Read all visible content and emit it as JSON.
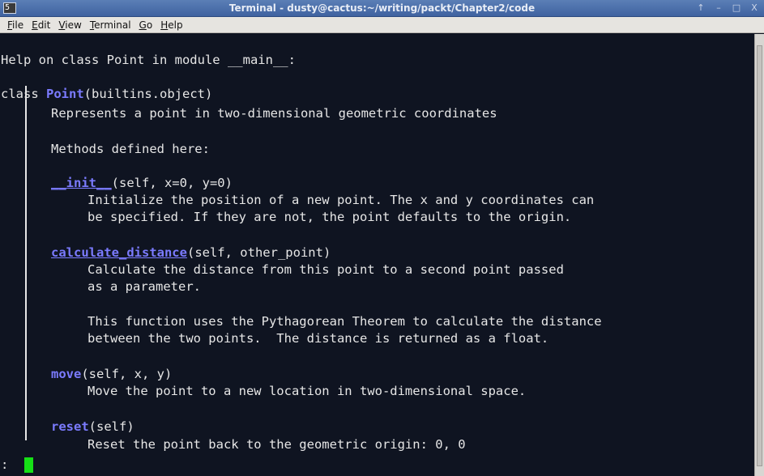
{
  "window": {
    "title": "Terminal - dusty@cactus:~/writing/packt/Chapter2/code",
    "app_icon_glyph": "5",
    "controls": [
      "↑",
      "–",
      "□",
      "X"
    ]
  },
  "menubar": {
    "items": [
      {
        "ul": "F",
        "rest": "ile"
      },
      {
        "ul": "E",
        "rest": "dit"
      },
      {
        "ul": "V",
        "rest": "iew"
      },
      {
        "ul": "T",
        "rest": "erminal"
      },
      {
        "ul": "G",
        "rest": "o"
      },
      {
        "ul": "H",
        "rest": "elp"
      }
    ]
  },
  "terminal": {
    "header": "Help on class Point in module __main__:",
    "class_prefix": "class ",
    "class_name": "Point",
    "class_suffix": "(builtins.object)",
    "docstring": "Represents a point in two-dimensional geometric coordinates",
    "methods_heading": "Methods defined here:",
    "init_name": "__init__",
    "init_sig": "(self, x=0, y=0)",
    "init_doc_1": "Initialize the position of a new point. The x and y coordinates can",
    "init_doc_2": "be specified. If they are not, the point defaults to the origin.",
    "calc_name": "calculate_distance",
    "calc_sig": "(self, other_point)",
    "calc_doc_1": "Calculate the distance from this point to a second point passed",
    "calc_doc_2": "as a parameter.",
    "calc_doc_3": "This function uses the Pythagorean Theorem to calculate the distance",
    "calc_doc_4": "between the two points.  The distance is returned as a float.",
    "move_name": "move",
    "move_sig": "(self, x, y)",
    "move_doc": "Move the point to a new location in two-dimensional space.",
    "reset_name": "reset",
    "reset_sig": "(self)",
    "reset_doc": "Reset the point back to the geometric origin: 0, 0",
    "prompt": ":"
  },
  "colors": {
    "background": "#0f1421",
    "text": "#e6e6e6",
    "keyword": "#7b7bff",
    "cursor": "#16e016"
  }
}
